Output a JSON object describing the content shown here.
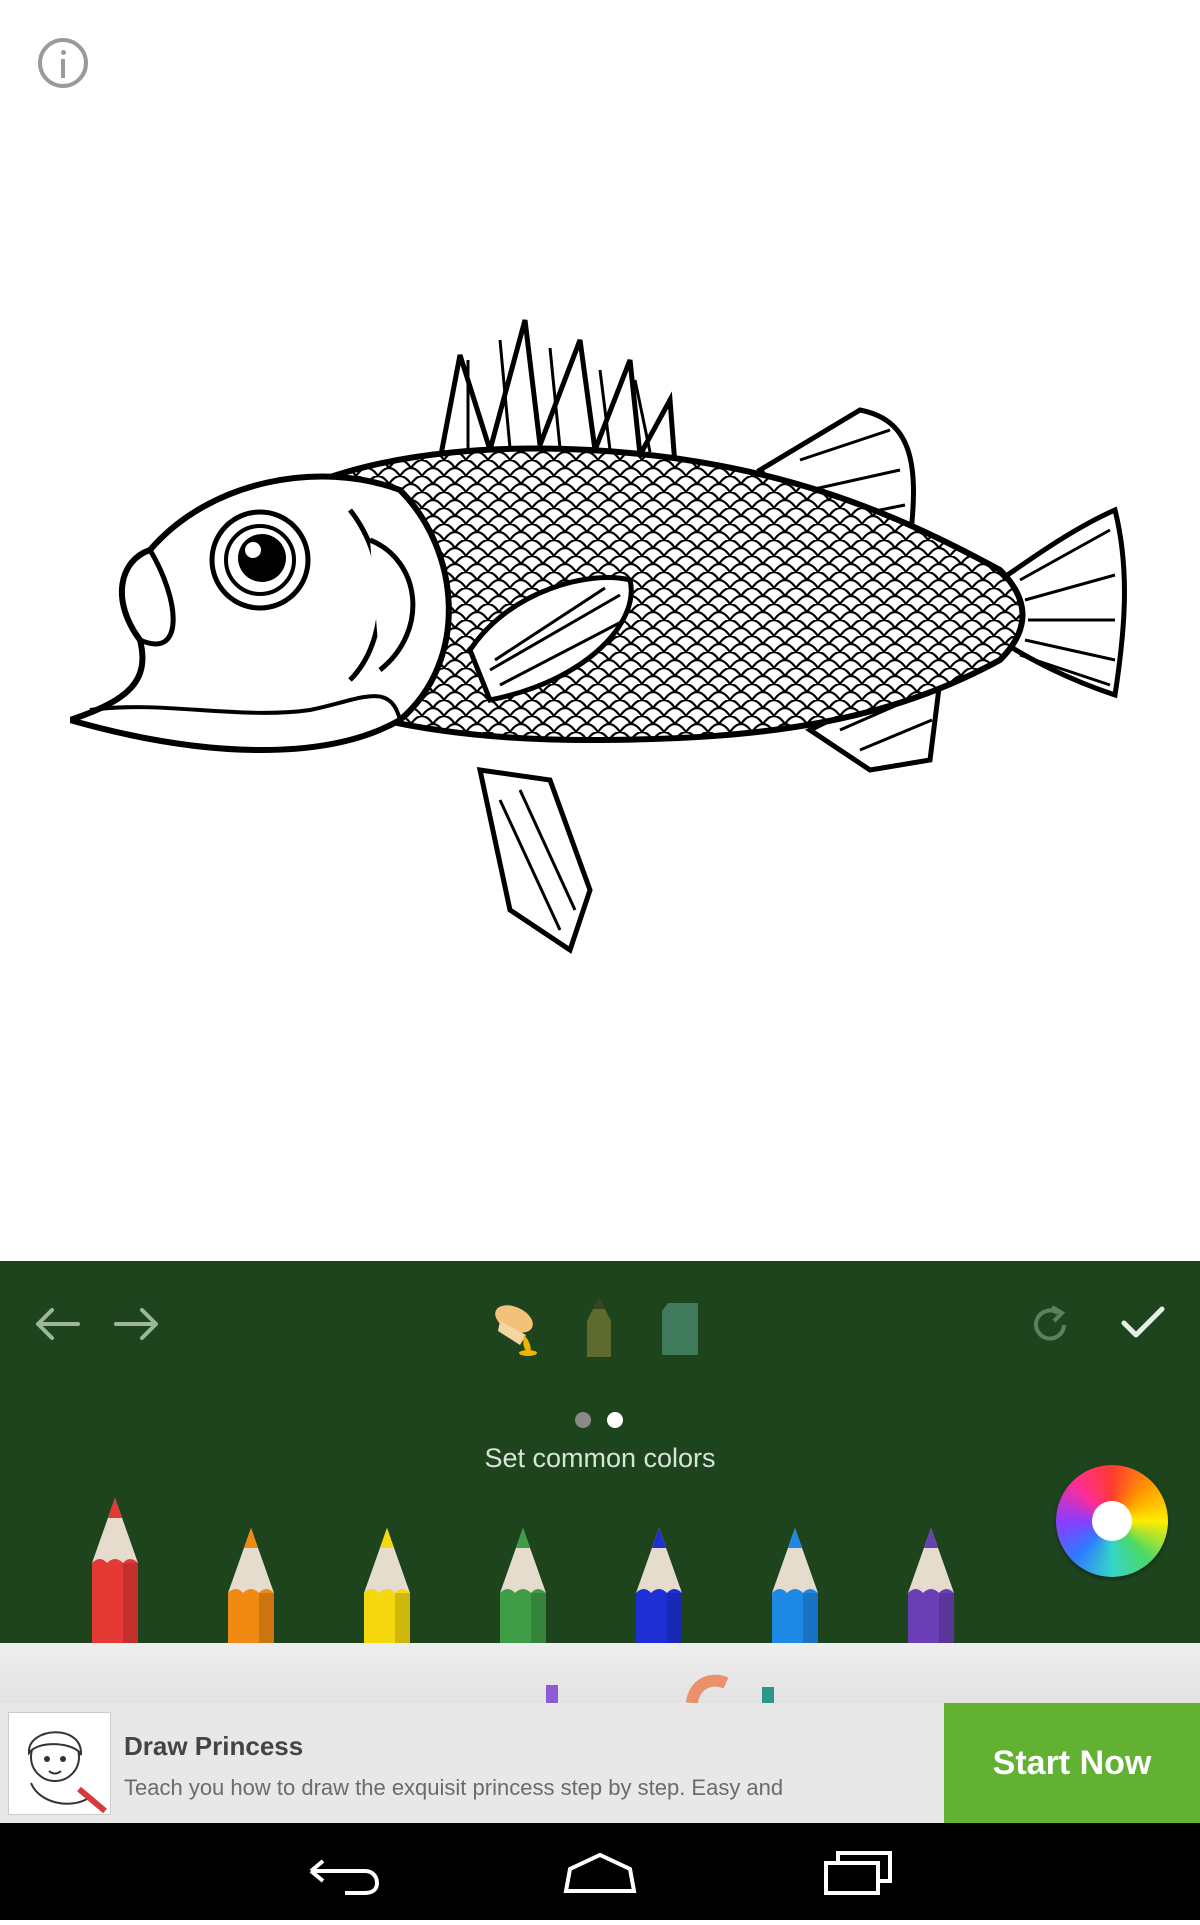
{
  "canvas": {
    "picture": "fish coloring page (line art)"
  },
  "toolbar": {
    "tools": [
      "paint-bucket",
      "pencil",
      "eraser"
    ],
    "page_dots": {
      "count": 2,
      "active_index": 1
    },
    "hint": "Set common colors",
    "pencils": [
      {
        "name": "red",
        "color": "#e53935",
        "selected": true
      },
      {
        "name": "orange",
        "color": "#f08a12",
        "selected": false
      },
      {
        "name": "yellow",
        "color": "#f6d80f",
        "selected": false
      },
      {
        "name": "green",
        "color": "#3e9d46",
        "selected": false
      },
      {
        "name": "blue",
        "color": "#1f2fd6",
        "selected": false
      },
      {
        "name": "sky",
        "color": "#1e88e5",
        "selected": false
      },
      {
        "name": "purple",
        "color": "#6a3fb5",
        "selected": false
      }
    ]
  },
  "ad": {
    "title": "Draw Princess",
    "description": "Teach you how to draw the exquisit princess step by step. Easy and",
    "cta": "Start Now"
  },
  "colors": {
    "toolbar_bg": "#1e441e",
    "accent_green": "#62b132",
    "hint_text": "#d9e4d9"
  }
}
